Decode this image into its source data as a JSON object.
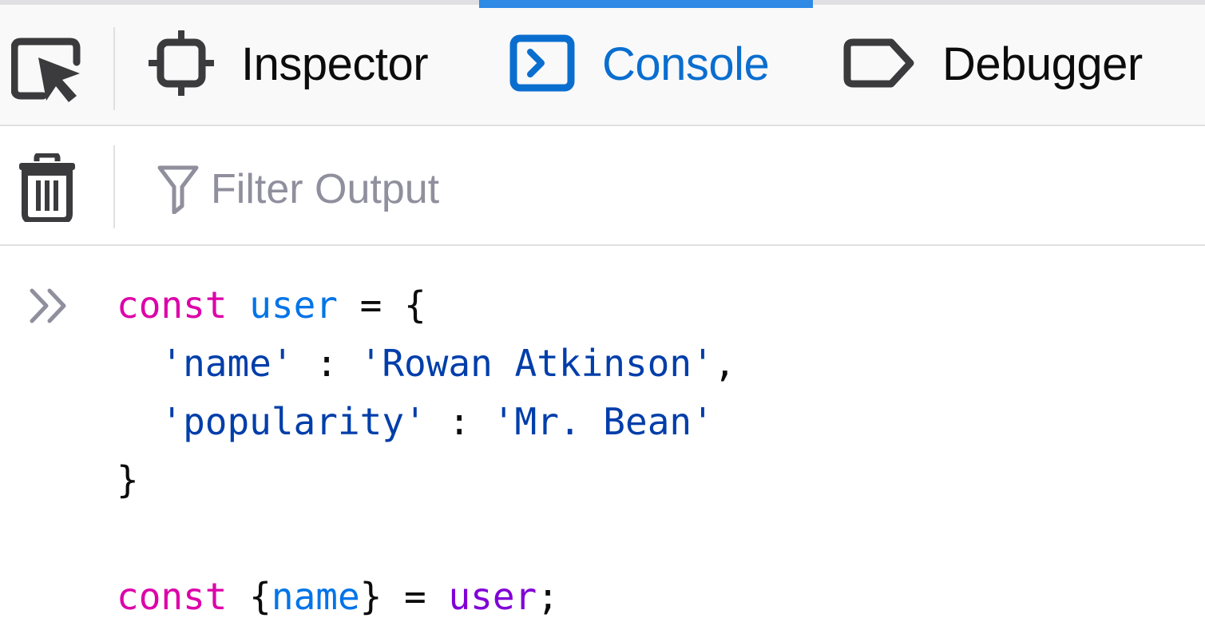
{
  "tabs": {
    "inspector_label": "Inspector",
    "console_label": "Console",
    "debugger_label": "Debugger"
  },
  "toolbar": {
    "filter_placeholder": "Filter Output"
  },
  "icons": {
    "picker": "element-picker-icon",
    "inspector": "inspector-icon",
    "console": "console-icon",
    "debugger": "debugger-icon",
    "trash": "trash-icon",
    "filter": "filter-icon",
    "prompt": "chevron-double-right-icon"
  },
  "colors": {
    "accent": "#0a6ecf",
    "active_tab_indicator": "#2f8ae6",
    "keyword": "#dd00a9",
    "variable": "#0074e8",
    "string": "#003eaa",
    "identifier_ref": "#8000d7"
  },
  "console": {
    "tokens": {
      "kw_const": "const",
      "user": "user",
      "name_str": "'name'",
      "rowan_str": "'Rowan Atkinson'",
      "popularity_str": "'popularity'",
      "mrbean_str": "'Mr. Bean'",
      "name_var": "name"
    }
  }
}
